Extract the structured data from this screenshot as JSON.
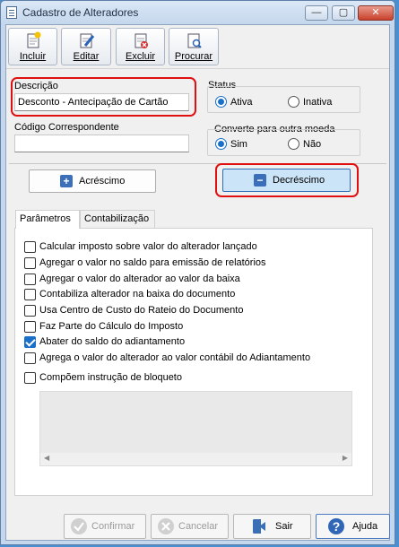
{
  "window": {
    "title": "Cadastro de Alteradores",
    "minimize": "—",
    "maximize": "▢",
    "close": "✕"
  },
  "toolbar": {
    "incluir": "Incluir",
    "editar": "Editar",
    "excluir": "Excluir",
    "procurar": "Procurar"
  },
  "form": {
    "descricao_label": "Descrição",
    "descricao_value": "Desconto - Antecipação de Cartão",
    "codigo_label": "Código Correspondente",
    "codigo_value": "",
    "status_label": "Status",
    "status_options": [
      "Ativa",
      "Inativa"
    ],
    "status_selected": "Ativa",
    "converte_label": "Converte para outra moeda",
    "converte_options": [
      "Sim",
      "Não"
    ],
    "converte_selected": "Sim"
  },
  "type_buttons": {
    "acrescimo": "Acréscimo",
    "decrescimo": "Decréscimo",
    "selected": "Decréscimo"
  },
  "tabs": [
    {
      "label": "Parâmetros",
      "active": true
    },
    {
      "label": "Contabilização",
      "active": false
    }
  ],
  "parameters": [
    {
      "label": "Calcular imposto sobre valor do alterador lançado",
      "checked": false
    },
    {
      "label": "Agregar o valor no saldo para emissão de relatórios",
      "checked": false
    },
    {
      "label": "Agregar o valor do alterador ao valor da baixa",
      "checked": false
    },
    {
      "label": "Contabiliza alterador na baixa do documento",
      "checked": false
    },
    {
      "label": "Usa Centro de Custo do Rateio do Documento",
      "checked": false
    },
    {
      "label": "Faz Parte do Cálculo do Imposto",
      "checked": false
    },
    {
      "label": "Abater do saldo do adiantamento",
      "checked": true
    },
    {
      "label": "Agrega o valor do alterador ao valor contábil do Adiantamento",
      "checked": false
    },
    {
      "label": "Compõem instrução de bloqueto",
      "checked": false
    }
  ],
  "footer": {
    "confirmar": "Confirmar",
    "cancelar": "Cancelar",
    "sair": "Sair",
    "ajuda": "Ajuda"
  },
  "colors": {
    "accent": "#1a6fc9",
    "highlight": "#e01010"
  }
}
